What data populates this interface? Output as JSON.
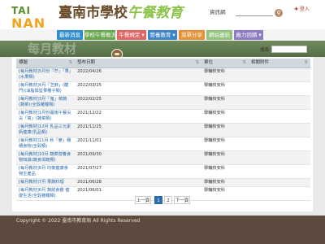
{
  "header": {
    "logo_top": "TAI",
    "logo_bottom": "NAN",
    "title_main": "臺南市學校",
    "title_accent": "午餐教育",
    "subtitle": "資訊網",
    "search_button": "⚲",
    "login": "✚ 登入"
  },
  "nav": {
    "items": [
      {
        "label": "最新消息",
        "color": "#2f8fce"
      },
      {
        "label": "學校午餐概況",
        "color": "#6aa84f"
      },
      {
        "label": "午餐規定 ▾",
        "color": "#e06666"
      },
      {
        "label": "營養教育 ▾",
        "color": "#3d85c6"
      },
      {
        "label": "菜單分享",
        "color": "#e69138"
      },
      {
        "label": "網站連結",
        "color": "#93c47d"
      },
      {
        "label": "廠力回饋 ▾",
        "color": "#8e7cc3"
      }
    ]
  },
  "banner": {
    "title": "每月教材"
  },
  "search": {
    "label": "搜尋:"
  },
  "table": {
    "headers": [
      "標題",
      "發布日期",
      "單位",
      "相關附件"
    ],
    "rows": [
      {
        "title": "[每月教材]5月份「芒」「果」(水果類)",
        "date": "2022/04/26",
        "unit": "學輔校安科",
        "attachment": ""
      },
      {
        "title": "[每月教材]4月「芝麻」(醣門)(油脂與堅果種子類)",
        "date": "2022/03/25",
        "unit": "學輔校安科",
        "attachment": ""
      },
      {
        "title": "[每月教材]3月「鬼」菜蔬(蔬菜)(全穀雜糧類)",
        "date": "2022/02/25",
        "unit": "學輔校安科",
        "attachment": ""
      },
      {
        "title": "[每月教材]1月份臺南午餐尖尖「寫」(蔬菜類)",
        "date": "2021/12/22",
        "unit": "學輔校安科",
        "attachment": ""
      },
      {
        "title": "[每月教材]12月 乳品三元素 鈣健康(乳品類)",
        "date": "2021/11/25",
        "unit": "學輔校安科",
        "attachment": ""
      },
      {
        "title": "[每月教材]11月 秋「麥」穗穗食物(全穀類)",
        "date": "2021/11/01",
        "unit": "學輔校安科",
        "attachment": ""
      },
      {
        "title": "[每月教材]10月 蔬菜營養食物知識(蔬食與蔬類)",
        "date": "2021/09/30",
        "unit": "學輔校安科",
        "attachment": ""
      },
      {
        "title": "[每月教材]8月 均衡健康食物生產品",
        "date": "2021/07/27",
        "unit": "學輔校安科",
        "attachment": ""
      },
      {
        "title": "[每月教材]7月 果蔬料理",
        "date": "2021/06/28",
        "unit": "學輔校安科",
        "attachment": ""
      },
      {
        "title": "[每月教材]6月 蔬飲食趣 健康生活(全穀雜糧類)",
        "date": "2021/06/01",
        "unit": "學輔校安科",
        "attachment": ""
      }
    ]
  },
  "pagination": {
    "prev": "上一頁",
    "pages": [
      "1",
      "2"
    ],
    "current": "1",
    "next": "下一頁"
  },
  "footer": {
    "text": "Copyright © 2022 臺南市教育局 All Rights Reserved"
  }
}
